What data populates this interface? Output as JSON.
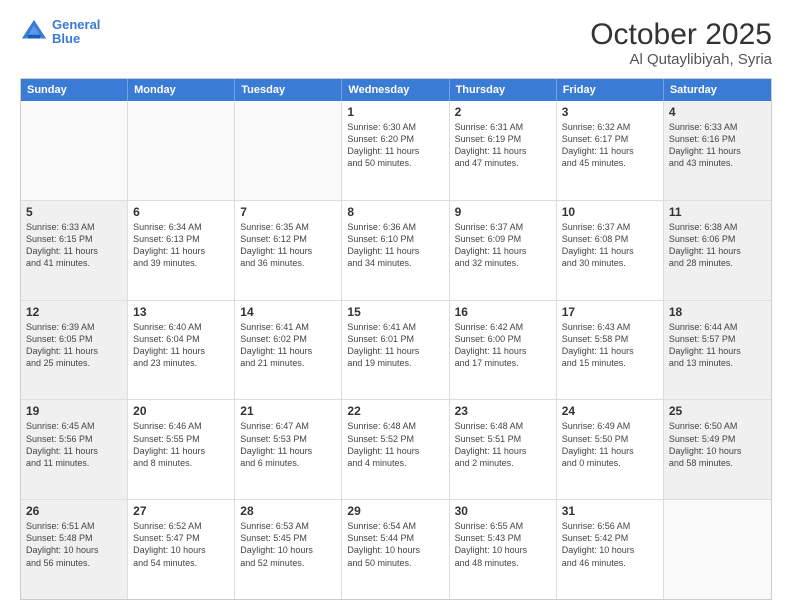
{
  "header": {
    "logo_line1": "General",
    "logo_line2": "Blue",
    "title": "October 2025",
    "subtitle": "Al Qutaylibiyah, Syria"
  },
  "weekdays": [
    "Sunday",
    "Monday",
    "Tuesday",
    "Wednesday",
    "Thursday",
    "Friday",
    "Saturday"
  ],
  "rows": [
    [
      {
        "day": "",
        "info": "",
        "empty": true
      },
      {
        "day": "",
        "info": "",
        "empty": true
      },
      {
        "day": "",
        "info": "",
        "empty": true
      },
      {
        "day": "1",
        "info": "Sunrise: 6:30 AM\nSunset: 6:20 PM\nDaylight: 11 hours\nand 50 minutes."
      },
      {
        "day": "2",
        "info": "Sunrise: 6:31 AM\nSunset: 6:19 PM\nDaylight: 11 hours\nand 47 minutes."
      },
      {
        "day": "3",
        "info": "Sunrise: 6:32 AM\nSunset: 6:17 PM\nDaylight: 11 hours\nand 45 minutes."
      },
      {
        "day": "4",
        "info": "Sunrise: 6:33 AM\nSunset: 6:16 PM\nDaylight: 11 hours\nand 43 minutes.",
        "shaded": true
      }
    ],
    [
      {
        "day": "5",
        "info": "Sunrise: 6:33 AM\nSunset: 6:15 PM\nDaylight: 11 hours\nand 41 minutes.",
        "shaded": true
      },
      {
        "day": "6",
        "info": "Sunrise: 6:34 AM\nSunset: 6:13 PM\nDaylight: 11 hours\nand 39 minutes."
      },
      {
        "day": "7",
        "info": "Sunrise: 6:35 AM\nSunset: 6:12 PM\nDaylight: 11 hours\nand 36 minutes."
      },
      {
        "day": "8",
        "info": "Sunrise: 6:36 AM\nSunset: 6:10 PM\nDaylight: 11 hours\nand 34 minutes."
      },
      {
        "day": "9",
        "info": "Sunrise: 6:37 AM\nSunset: 6:09 PM\nDaylight: 11 hours\nand 32 minutes."
      },
      {
        "day": "10",
        "info": "Sunrise: 6:37 AM\nSunset: 6:08 PM\nDaylight: 11 hours\nand 30 minutes."
      },
      {
        "day": "11",
        "info": "Sunrise: 6:38 AM\nSunset: 6:06 PM\nDaylight: 11 hours\nand 28 minutes.",
        "shaded": true
      }
    ],
    [
      {
        "day": "12",
        "info": "Sunrise: 6:39 AM\nSunset: 6:05 PM\nDaylight: 11 hours\nand 25 minutes.",
        "shaded": true
      },
      {
        "day": "13",
        "info": "Sunrise: 6:40 AM\nSunset: 6:04 PM\nDaylight: 11 hours\nand 23 minutes."
      },
      {
        "day": "14",
        "info": "Sunrise: 6:41 AM\nSunset: 6:02 PM\nDaylight: 11 hours\nand 21 minutes."
      },
      {
        "day": "15",
        "info": "Sunrise: 6:41 AM\nSunset: 6:01 PM\nDaylight: 11 hours\nand 19 minutes."
      },
      {
        "day": "16",
        "info": "Sunrise: 6:42 AM\nSunset: 6:00 PM\nDaylight: 11 hours\nand 17 minutes."
      },
      {
        "day": "17",
        "info": "Sunrise: 6:43 AM\nSunset: 5:58 PM\nDaylight: 11 hours\nand 15 minutes."
      },
      {
        "day": "18",
        "info": "Sunrise: 6:44 AM\nSunset: 5:57 PM\nDaylight: 11 hours\nand 13 minutes.",
        "shaded": true
      }
    ],
    [
      {
        "day": "19",
        "info": "Sunrise: 6:45 AM\nSunset: 5:56 PM\nDaylight: 11 hours\nand 11 minutes.",
        "shaded": true
      },
      {
        "day": "20",
        "info": "Sunrise: 6:46 AM\nSunset: 5:55 PM\nDaylight: 11 hours\nand 8 minutes."
      },
      {
        "day": "21",
        "info": "Sunrise: 6:47 AM\nSunset: 5:53 PM\nDaylight: 11 hours\nand 6 minutes."
      },
      {
        "day": "22",
        "info": "Sunrise: 6:48 AM\nSunset: 5:52 PM\nDaylight: 11 hours\nand 4 minutes."
      },
      {
        "day": "23",
        "info": "Sunrise: 6:48 AM\nSunset: 5:51 PM\nDaylight: 11 hours\nand 2 minutes."
      },
      {
        "day": "24",
        "info": "Sunrise: 6:49 AM\nSunset: 5:50 PM\nDaylight: 11 hours\nand 0 minutes."
      },
      {
        "day": "25",
        "info": "Sunrise: 6:50 AM\nSunset: 5:49 PM\nDaylight: 10 hours\nand 58 minutes.",
        "shaded": true
      }
    ],
    [
      {
        "day": "26",
        "info": "Sunrise: 6:51 AM\nSunset: 5:48 PM\nDaylight: 10 hours\nand 56 minutes.",
        "shaded": true
      },
      {
        "day": "27",
        "info": "Sunrise: 6:52 AM\nSunset: 5:47 PM\nDaylight: 10 hours\nand 54 minutes."
      },
      {
        "day": "28",
        "info": "Sunrise: 6:53 AM\nSunset: 5:45 PM\nDaylight: 10 hours\nand 52 minutes."
      },
      {
        "day": "29",
        "info": "Sunrise: 6:54 AM\nSunset: 5:44 PM\nDaylight: 10 hours\nand 50 minutes."
      },
      {
        "day": "30",
        "info": "Sunrise: 6:55 AM\nSunset: 5:43 PM\nDaylight: 10 hours\nand 48 minutes."
      },
      {
        "day": "31",
        "info": "Sunrise: 6:56 AM\nSunset: 5:42 PM\nDaylight: 10 hours\nand 46 minutes."
      },
      {
        "day": "",
        "info": "",
        "empty": true
      }
    ]
  ]
}
